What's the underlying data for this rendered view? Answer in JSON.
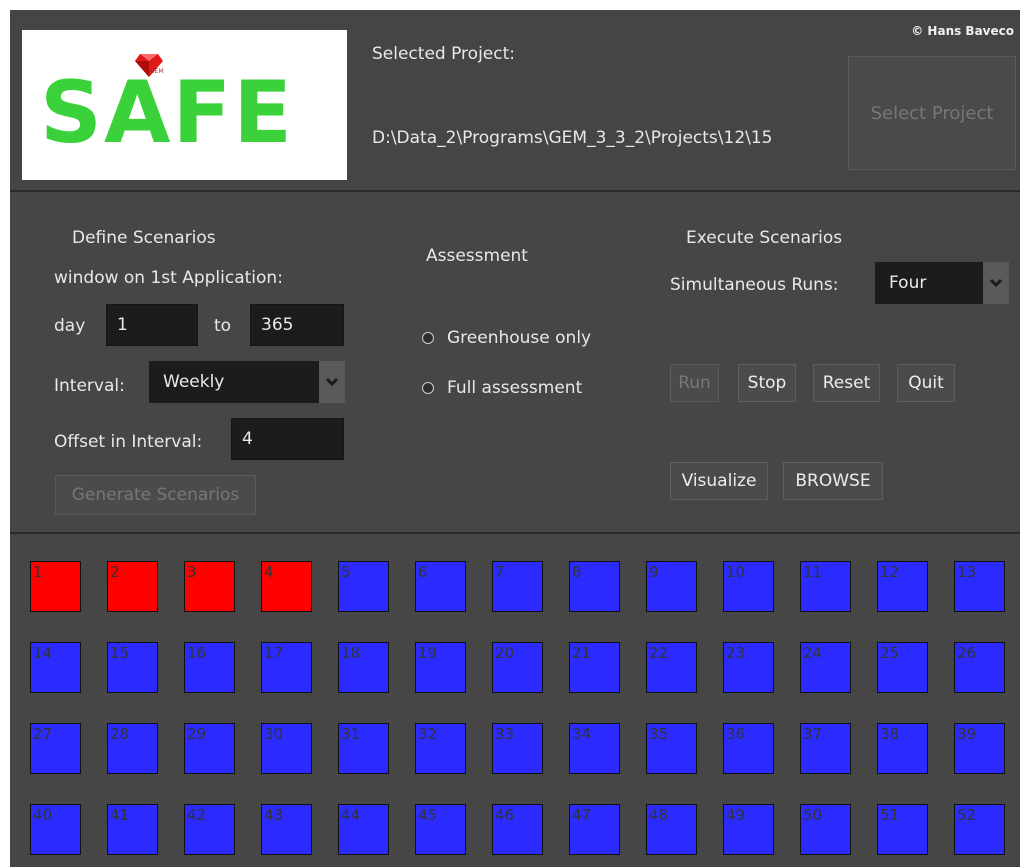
{
  "header": {
    "logo_text": "SAFE",
    "logo_gem_label": "GEM",
    "copyright": "© Hans Baveco",
    "selected_project_label": "Selected Project:",
    "project_path": "D:\\Data_2\\Programs\\GEM_3_3_2\\Projects\\12\\15",
    "select_project_button": "Select Project"
  },
  "define": {
    "title": "Define Scenarios",
    "window_label": "window on 1st Application:",
    "day_label": "day",
    "day_from": "1",
    "to_label": "to",
    "day_to": "365",
    "interval_label": "Interval:",
    "interval_value": "Weekly",
    "offset_label": "Offset in Interval:",
    "offset_value": "4",
    "generate_button": "Generate Scenarios"
  },
  "assessment": {
    "title": "Assessment",
    "options": [
      "Greenhouse only",
      "Full assessment"
    ]
  },
  "execute": {
    "title": "Execute Scenarios",
    "sim_label": "Simultaneous Runs:",
    "sim_value": "Four",
    "run": "Run",
    "stop": "Stop",
    "reset": "Reset",
    "quit": "Quit",
    "visualize": "Visualize",
    "browse": "BROWSE"
  },
  "scenarios": {
    "colors": {
      "done": "#ff0000",
      "pending": "#2b2bff"
    },
    "done_count": 4,
    "labels": [
      "1",
      "2",
      "3",
      "4",
      "5",
      "6",
      "7",
      "8",
      "9",
      "10",
      "11",
      "12",
      "13",
      "14",
      "15",
      "16",
      "17",
      "18",
      "19",
      "20",
      "21",
      "22",
      "23",
      "24",
      "25",
      "26",
      "27",
      "28",
      "29",
      "30",
      "31",
      "32",
      "33",
      "34",
      "35",
      "36",
      "37",
      "38",
      "39",
      "40",
      "41",
      "42",
      "43",
      "44",
      "45",
      "46",
      "47",
      "48",
      "49",
      "50",
      "51",
      "52"
    ]
  }
}
